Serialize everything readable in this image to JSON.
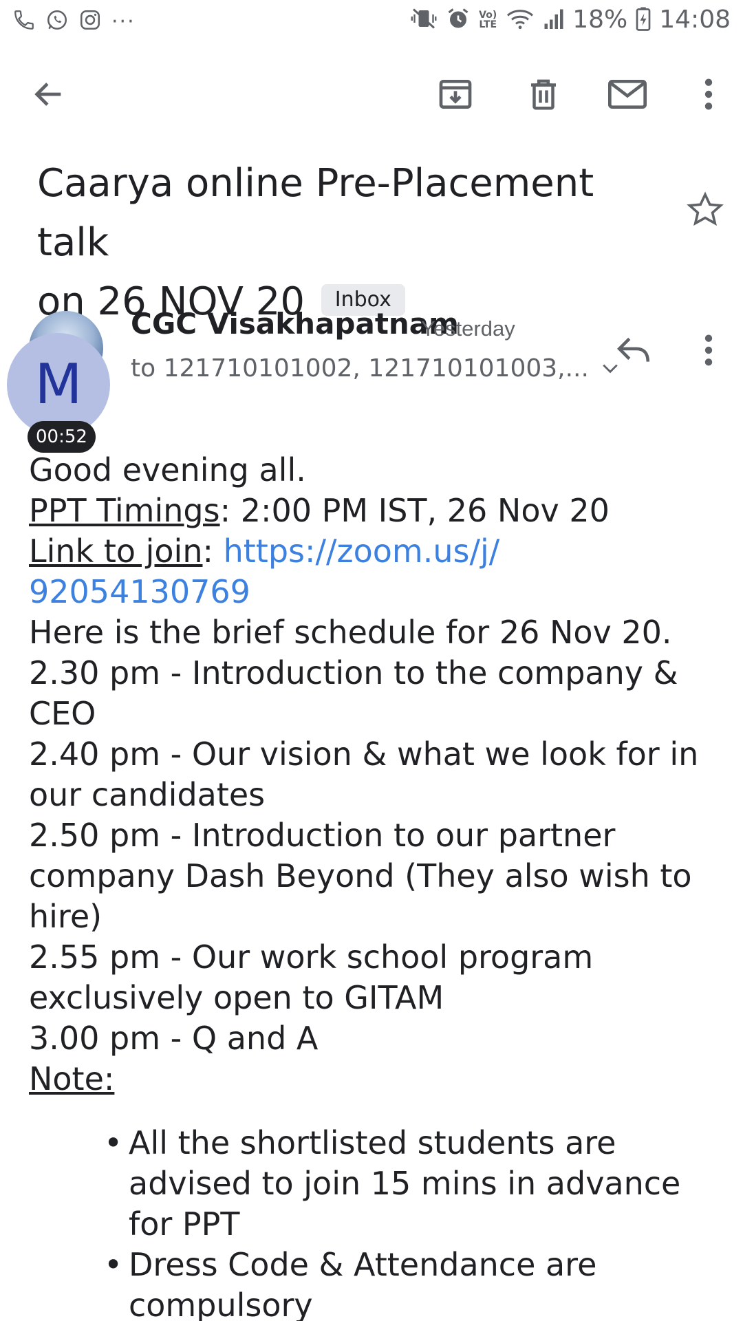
{
  "status_bar": {
    "battery": "18%",
    "time": "14:08",
    "volte_top": "Vo)",
    "volte_bottom": "LTE",
    "more": "···"
  },
  "toolbar": {
    "back": "back-arrow-icon",
    "archive": "archive-icon",
    "delete": "trash-icon",
    "mark_unread": "mail-icon",
    "more": "more-vert-icon"
  },
  "email": {
    "subject_line1": "Caarya online Pre-Placement talk",
    "subject_line2": "on 26 NOV 20",
    "label": "Inbox",
    "sender": "CGC Visakhapatnam",
    "time": "Yesterday",
    "recipients": "to 121710101002, 121710101003,...",
    "avatar_letter": "M",
    "timer": "00:52"
  },
  "body": {
    "greeting": "Good evening all.",
    "ppt_label": "PPT Timings",
    "ppt_value": ": 2:00 PM IST, 26 Nov 20",
    "link_label": "Link to join",
    "link_sep": ": ",
    "link_part1": "https://zoom.us/j/",
    "link_part2": "92054130769",
    "schedule_intro": "Here is the brief schedule for 26 Nov 20.",
    "s1a": "2.30 pm - Introduction to the company &",
    "s1b": "CEO",
    "s2a": "2.40 pm - Our vision & what we look for in",
    "s2b": "our candidates",
    "s3a": "2.50 pm - Introduction to our partner",
    "s3b": "company Dash Beyond (They also wish to",
    "s3c": "hire)",
    "s4a": "2.55 pm - Our work school program",
    "s4b": "exclusively open to GITAM",
    "s5": "3.00 pm - Q and A",
    "note_label": "Note:",
    "bullet1a": "All the shortlisted students are",
    "bullet1b": "advised to join 15 mins in advance",
    "bullet1c": "for PPT",
    "bullet2a": "Dress Code & Attendance are",
    "bullet2b": "compulsory"
  },
  "colors": {
    "link": "#3c80e0",
    "avatar_bg": "#b4bfe3",
    "avatar_text": "#22339a",
    "chip_bg": "#e8eaed"
  }
}
